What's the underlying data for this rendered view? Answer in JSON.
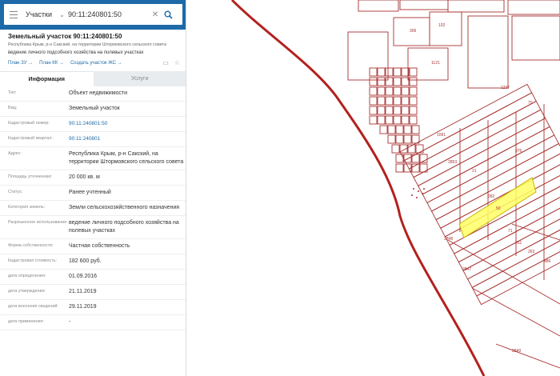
{
  "search": {
    "category": "Участки",
    "query": "90:11:240801:50"
  },
  "parcel": {
    "title": "Земельный участок 90:11:240801:50",
    "address_short": "Республика Крым, р-н Сакский, на территории Штормовского сельского совета",
    "use": "ведение личного подсобного хозяйства на полевых участках",
    "links": [
      "План ЗУ →",
      "План КК →",
      "Создать участок ЖС →"
    ]
  },
  "tabs": [
    "Информация",
    "Услуги"
  ],
  "info": [
    {
      "key": "Тип:",
      "value": "Объект недвижимости"
    },
    {
      "key": "Вид:",
      "value": "Земельный участок"
    },
    {
      "key": "Кадастровый номер:",
      "value": "90:11:240801:50"
    },
    {
      "key": "Кадастровый квартал:",
      "value": "90:11:240801"
    },
    {
      "key": "Адрес:",
      "value": "Республика Крым, р-н Сакский, на территории Штормовского сельского совета"
    },
    {
      "key": "Площадь уточненная:",
      "value": "20 000 кв. м"
    },
    {
      "key": "Статус:",
      "value": "Ранее учтенный"
    },
    {
      "key": "Категория земель:",
      "value": "Земли сельскохозяйственного назначения"
    },
    {
      "key": "Разрешенное использование:",
      "value": "ведение личного подсобного хозяйства на полевых участках"
    },
    {
      "key": "Форма собственности:",
      "value": "Частная собственность"
    },
    {
      "key": "Кадастровая стоимость:",
      "value": "182 600 руб."
    },
    {
      "key": "дата определения:",
      "value": "01.09.2016"
    },
    {
      "key": "дата утверждения:",
      "value": "21.11.2019"
    },
    {
      "key": "дата внесения сведений:",
      "value": "29.11.2019"
    },
    {
      "key": "дата применения:",
      "value": "-"
    }
  ],
  "map_labels": [
    "306",
    "102",
    "1121",
    "1237",
    "70",
    "376",
    "21",
    "282",
    "50",
    "71",
    "261",
    "263",
    "486",
    "2848",
    "2847",
    "2849",
    "1091",
    "2853"
  ],
  "colors": {
    "header": "#1e6aa8",
    "plot_line": "#a83232",
    "highlight": "#ffff66",
    "link": "#1e6aa8"
  }
}
